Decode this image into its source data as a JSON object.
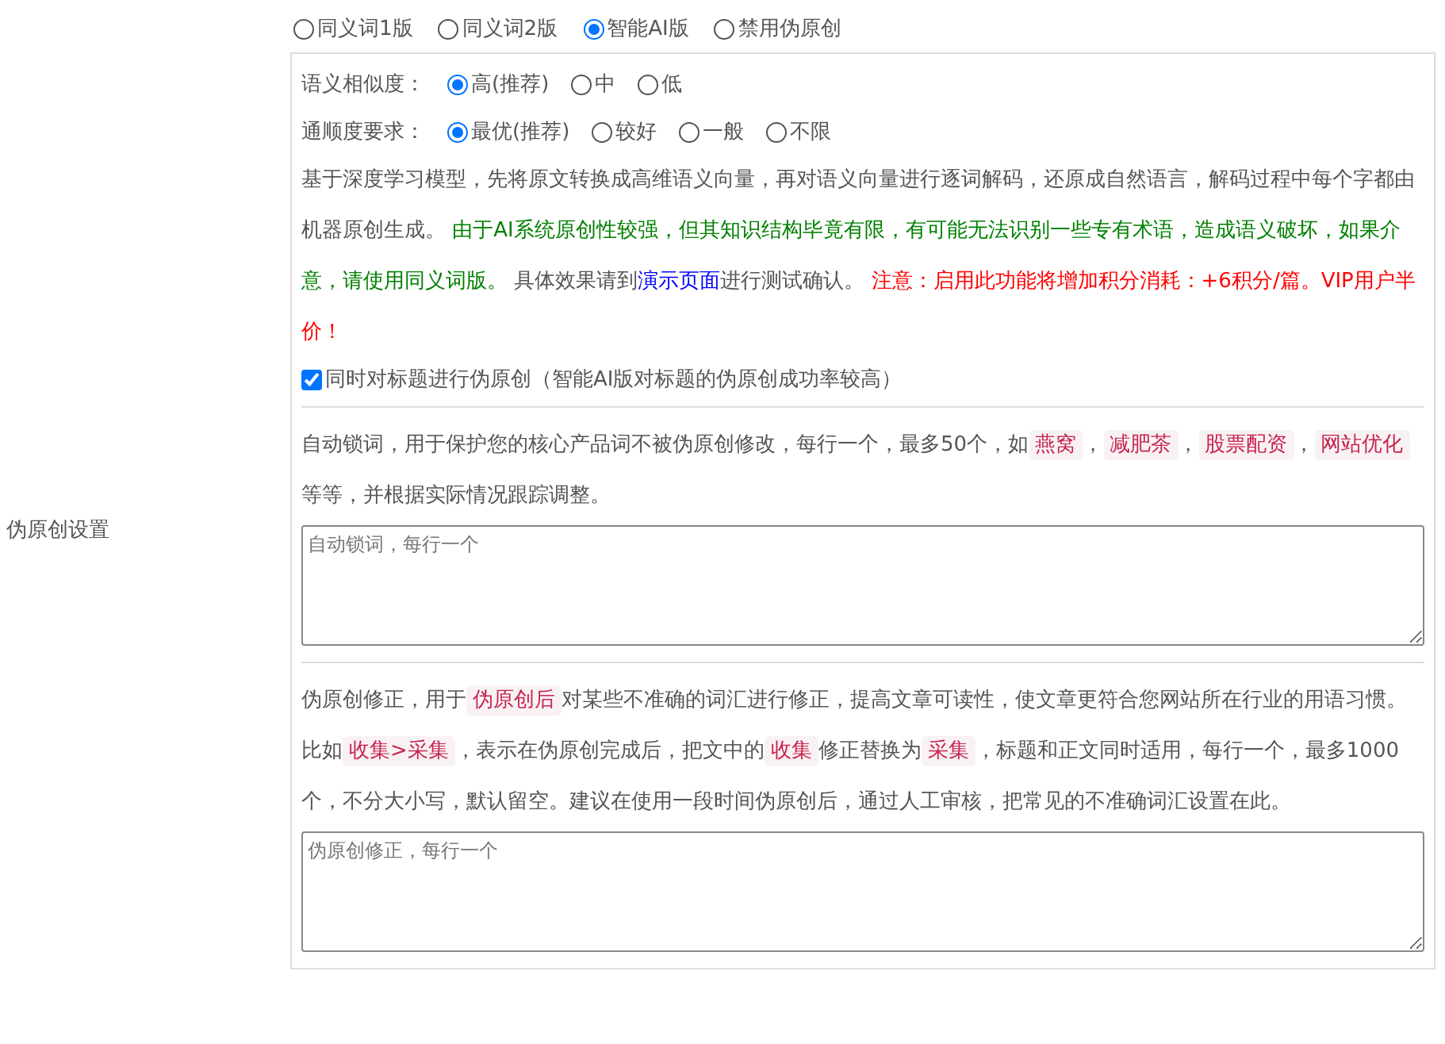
{
  "section_label": "伪原创设置",
  "modes": [
    {
      "label": "同义词1版",
      "selected": false
    },
    {
      "label": "同义词2版",
      "selected": false
    },
    {
      "label": "智能AI版",
      "selected": true
    },
    {
      "label": "禁用伪原创",
      "selected": false
    }
  ],
  "settings": [
    {
      "label": "语义相似度：",
      "options": [
        {
          "label": "高(推荐)",
          "selected": true
        },
        {
          "label": "中",
          "selected": false
        },
        {
          "label": "低",
          "selected": false
        }
      ]
    },
    {
      "label": "通顺度要求：",
      "options": [
        {
          "label": "最优(推荐)",
          "selected": true
        },
        {
          "label": "较好",
          "selected": false
        },
        {
          "label": "一般",
          "selected": false
        },
        {
          "label": "不限",
          "selected": false
        }
      ]
    }
  ],
  "ai_description": [
    {
      "kind": "plain",
      "text": "基于深度学习模型，先将原文转换成高维语义向量，再对语义向量进行逐词解码，还原成自然语言，解码过程中每个字都由机器原创生成。 "
    },
    {
      "kind": "green",
      "text": "由于AI系统原创性较强，但其知识结构毕竟有限，有可能无法识别一些专有术语，造成语义破坏，如果介意，请使用同义词版。"
    },
    {
      "kind": "plain",
      "text": " 具体效果请到"
    },
    {
      "kind": "link",
      "text": "演示页面"
    },
    {
      "kind": "plain",
      "text": "进行测试确认。 "
    },
    {
      "kind": "red",
      "text": "注意：启用此功能将增加积分消耗：+6积分/篇。VIP用户半价！"
    }
  ],
  "title_checkbox": {
    "label": "同时对标题进行伪原创（智能AI版对标题的伪原创成功率较高）",
    "checked": true
  },
  "sections": [
    {
      "description": [
        {
          "kind": "plain",
          "text": "自动锁词，用于保护您的核心产品词不被伪原创修改，每行一个，最多50个，如"
        },
        {
          "kind": "tag",
          "text": "燕窝"
        },
        {
          "kind": "plain",
          "text": "，"
        },
        {
          "kind": "tag",
          "text": "减肥茶"
        },
        {
          "kind": "plain",
          "text": "，"
        },
        {
          "kind": "tag",
          "text": "股票配资"
        },
        {
          "kind": "plain",
          "text": "，"
        },
        {
          "kind": "tag",
          "text": "网站优化"
        },
        {
          "kind": "plain",
          "text": " 等等，并根据实际情况跟踪调整。"
        }
      ],
      "placeholder": "自动锁词，每行一个"
    },
    {
      "description": [
        {
          "kind": "plain",
          "text": "伪原创修正，用于"
        },
        {
          "kind": "tag",
          "text": "伪原创后"
        },
        {
          "kind": "plain",
          "text": "对某些不准确的词汇进行修正，提高文章可读性，使文章更符合您网站所在行业的用语习惯。比如"
        },
        {
          "kind": "tag",
          "text": "收集>采集"
        },
        {
          "kind": "plain",
          "text": "，表示在伪原创完成后，把文中的"
        },
        {
          "kind": "tag",
          "text": "收集"
        },
        {
          "kind": "plain",
          "text": "修正替换为"
        },
        {
          "kind": "tag",
          "text": "采集"
        },
        {
          "kind": "plain",
          "text": "，标题和正文同时适用，每行一个，最多1000个，不分大小写，默认留空。建议在使用一段时间伪原创后，通过人工审核，把常见的不准确词汇设置在此。"
        }
      ],
      "placeholder": "伪原创修正，每行一个"
    }
  ]
}
